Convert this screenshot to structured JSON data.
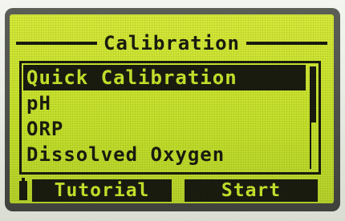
{
  "screen": {
    "title": "Calibration",
    "menu_items": [
      {
        "label": "Quick Calibration",
        "selected": true
      },
      {
        "label": "pH",
        "selected": false
      },
      {
        "label": "ORP",
        "selected": false
      },
      {
        "label": "Dissolved Oxygen",
        "selected": false
      }
    ],
    "softkeys": {
      "left_label": "Tutorial",
      "right_label": "Start"
    },
    "battery_icon": "battery-icon"
  },
  "colors": {
    "lcd_background": "#c8e42c",
    "lcd_ink": "#1a1c10",
    "bezel": "#4a4d45"
  }
}
